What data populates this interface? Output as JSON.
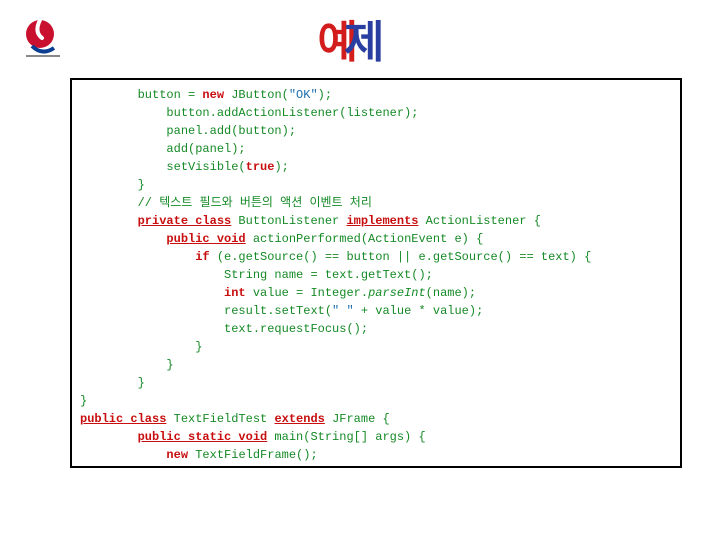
{
  "title": {
    "part1": "예",
    "part2": "제"
  },
  "code": {
    "l01a": "        button = ",
    "l01b": "new",
    "l01c": " JButton(",
    "l01d": "\"OK\"",
    "l01e": ");",
    "l02": "            button.addActionListener(listener);",
    "l03": "            panel.add(button);",
    "l04": "            add(panel);",
    "l05a": "            setVisible(",
    "l05b": "true",
    "l05c": ");",
    "l06": "        }",
    "l07": "        // 텍스트 필드와 버튼의 액션 이벤트 처리",
    "l08a": "        ",
    "l08b": "private class",
    "l08c": " ButtonListener ",
    "l08d": "implements",
    "l08e": " ActionListener {",
    "l09a": "            ",
    "l09b": "public void",
    "l09c": " actionPerformed(ActionEvent e) {",
    "l10a": "                ",
    "l10b": "if",
    "l10c": " (e.getSource() == button || e.getSource() == text) {",
    "l11": "                    String name = text.getText();",
    "l12a": "                    ",
    "l12b": "int",
    "l12c": " value = Integer.",
    "l12d": "parseInt",
    "l12e": "(name);",
    "l13a": "                    result.setText(",
    "l13b": "\" \"",
    "l13c": " + value * value);",
    "l14": "                    text.requestFocus();",
    "l15": "                }",
    "l16": "            }",
    "l17": "        }",
    "l18": "}",
    "l19a": "public class",
    "l19b": " TextFieldTest ",
    "l19c": "extends",
    "l19d": " JFrame {",
    "l20a": "        ",
    "l20b": "public static void",
    "l20c": " main(String[] args) {",
    "l21a": "            ",
    "l21b": "new",
    "l21c": " TextFieldFrame();",
    "l22": "        }",
    "l23": "}"
  }
}
